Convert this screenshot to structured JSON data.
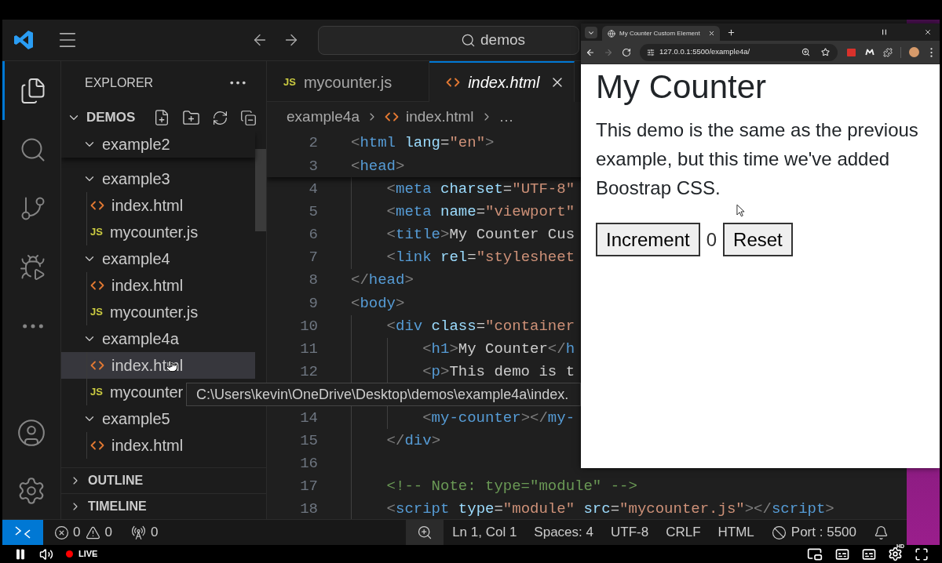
{
  "title_bar": {
    "command_center": {
      "label": "demos"
    }
  },
  "activity_bar": {
    "items": [
      {
        "kind": "explorer",
        "selected": true
      },
      {
        "kind": "search",
        "selected": false
      },
      {
        "kind": "source_control",
        "selected": false
      },
      {
        "kind": "run_debug",
        "selected": false
      },
      {
        "kind": "more",
        "selected": false
      }
    ],
    "bottom": [
      {
        "kind": "account"
      },
      {
        "kind": "settings"
      }
    ]
  },
  "sidebar": {
    "title": "EXPLORER",
    "root": {
      "name": "DEMOS",
      "expanded": true
    },
    "tree": [
      {
        "kind": "folder",
        "name": "example2",
        "expanded": true
      },
      {
        "kind": "folder",
        "name": "example3",
        "expanded": true,
        "children": [
          {
            "kind": "html",
            "name": "index.html",
            "selected": false
          },
          {
            "kind": "js",
            "icon_label": "JS",
            "name": "mycounter.js",
            "selected": false
          }
        ]
      },
      {
        "kind": "folder",
        "name": "example4",
        "expanded": true,
        "children": [
          {
            "kind": "html",
            "name": "index.html",
            "selected": false
          },
          {
            "kind": "js",
            "icon_label": "JS",
            "name": "mycounter.js",
            "selected": false
          }
        ]
      },
      {
        "kind": "folder",
        "name": "example4a",
        "expanded": true,
        "children": [
          {
            "kind": "html",
            "name": "index.html",
            "selected": true
          },
          {
            "kind": "js",
            "icon_label": "JS",
            "name": "mycounter",
            "selected": false
          }
        ]
      },
      {
        "kind": "folder",
        "name": "example5",
        "expanded": true,
        "children": [
          {
            "kind": "html",
            "name": "index.html",
            "selected": false
          }
        ]
      }
    ],
    "sections": [
      {
        "name": "OUTLINE",
        "expanded": false
      },
      {
        "name": "TIMELINE",
        "expanded": false
      }
    ]
  },
  "tooltip": {
    "text": "C:\\Users\\kevin\\OneDrive\\Desktop\\demos\\example4a\\index."
  },
  "editor": {
    "tabs": [
      {
        "kind": "js",
        "icon_label": "JS",
        "label": "mycounter.js",
        "selected": false,
        "preview": false
      },
      {
        "kind": "html",
        "label": "index.html",
        "selected": true,
        "preview": true
      }
    ],
    "breadcrumbs": [
      {
        "kind": "folder",
        "label": "example4a"
      },
      {
        "kind": "html",
        "label": "index.html"
      },
      {
        "kind": "more",
        "label": "…"
      }
    ],
    "lines": [
      {
        "number": "2",
        "tokens": [
          {
            "kind": "punct",
            "text": "<"
          },
          {
            "kind": "tag",
            "text": "html"
          },
          {
            "kind": "attr",
            "text": " lang"
          },
          {
            "kind": "text",
            "text": "="
          },
          {
            "kind": "string",
            "text": "\"en\""
          },
          {
            "kind": "punct",
            "text": ">"
          }
        ]
      },
      {
        "number": "3",
        "tokens": [
          {
            "kind": "punct",
            "text": "<"
          },
          {
            "kind": "tag",
            "text": "head"
          },
          {
            "kind": "punct",
            "text": ">"
          }
        ],
        "children": [
          {
            "number": "4",
            "tokens": [
              {
                "kind": "punct",
                "text": "<"
              },
              {
                "kind": "tag",
                "text": "meta"
              },
              {
                "kind": "attr",
                "text": " charset"
              },
              {
                "kind": "text",
                "text": "="
              },
              {
                "kind": "string",
                "text": "\"UTF-8\""
              }
            ]
          },
          {
            "number": "5",
            "tokens": [
              {
                "kind": "punct",
                "text": "<"
              },
              {
                "kind": "tag",
                "text": "meta"
              },
              {
                "kind": "attr",
                "text": " name"
              },
              {
                "kind": "text",
                "text": "="
              },
              {
                "kind": "string",
                "text": "\"viewport\""
              }
            ]
          },
          {
            "number": "6",
            "tokens": [
              {
                "kind": "punct",
                "text": "<"
              },
              {
                "kind": "tag",
                "text": "title"
              },
              {
                "kind": "punct",
                "text": ">"
              },
              {
                "kind": "text",
                "text": "My Counter Cus"
              }
            ]
          },
          {
            "number": "7",
            "tokens": [
              {
                "kind": "punct",
                "text": "<"
              },
              {
                "kind": "tag",
                "text": "link"
              },
              {
                "kind": "attr",
                "text": " rel"
              },
              {
                "kind": "text",
                "text": "="
              },
              {
                "kind": "string",
                "text": "\"stylesheet"
              }
            ]
          }
        ]
      },
      {
        "number": "8",
        "tokens": [
          {
            "kind": "punct",
            "text": "</"
          },
          {
            "kind": "tag",
            "text": "head"
          },
          {
            "kind": "punct",
            "text": ">"
          }
        ]
      },
      {
        "number": "9",
        "tokens": [
          {
            "kind": "punct",
            "text": "<"
          },
          {
            "kind": "tag",
            "text": "body"
          },
          {
            "kind": "punct",
            "text": ">"
          }
        ],
        "children": [
          {
            "number": "10",
            "tokens": [
              {
                "kind": "punct",
                "text": "<"
              },
              {
                "kind": "tag",
                "text": "div"
              },
              {
                "kind": "attr",
                "text": " class"
              },
              {
                "kind": "text",
                "text": "="
              },
              {
                "kind": "string",
                "text": "\"container"
              }
            ],
            "children": [
              {
                "number": "11",
                "tokens": [
                  {
                    "kind": "punct",
                    "text": "<"
                  },
                  {
                    "kind": "tag",
                    "text": "h1"
                  },
                  {
                    "kind": "punct",
                    "text": ">"
                  },
                  {
                    "kind": "text",
                    "text": "My Counter"
                  },
                  {
                    "kind": "punct",
                    "text": "</"
                  },
                  {
                    "kind": "tag",
                    "text": "h"
                  }
                ]
              },
              {
                "number": "12",
                "tokens": [
                  {
                    "kind": "punct",
                    "text": "<"
                  },
                  {
                    "kind": "tag",
                    "text": "p"
                  },
                  {
                    "kind": "punct",
                    "text": ">"
                  },
                  {
                    "kind": "text",
                    "text": "This demo is t"
                  }
                ]
              },
              {
                "number": "14",
                "tokens": [
                  {
                    "kind": "punct",
                    "text": "<"
                  },
                  {
                    "kind": "tag",
                    "text": "my-counter"
                  },
                  {
                    "kind": "punct",
                    "text": "></"
                  },
                  {
                    "kind": "tag",
                    "text": "my-"
                  }
                ]
              }
            ]
          },
          {
            "number": "15",
            "tokens": [
              {
                "kind": "punct",
                "text": "</"
              },
              {
                "kind": "tag",
                "text": "div"
              },
              {
                "kind": "punct",
                "text": ">"
              }
            ]
          },
          {
            "number": "16"
          },
          {
            "number": "17",
            "tokens": [
              {
                "kind": "comment",
                "text": "<!-- Note: type=\"module\" -->"
              }
            ]
          },
          {
            "number": "18",
            "tokens": [
              {
                "kind": "punct",
                "text": "<"
              },
              {
                "kind": "tag",
                "text": "script"
              },
              {
                "kind": "attr",
                "text": " type"
              },
              {
                "kind": "text",
                "text": "="
              },
              {
                "kind": "string",
                "text": "\"module\""
              },
              {
                "kind": "attr",
                "text": " src"
              },
              {
                "kind": "text",
                "text": "="
              },
              {
                "kind": "string",
                "text": "\"mycounter.js\""
              },
              {
                "kind": "punct",
                "text": "></"
              },
              {
                "kind": "tag",
                "text": "script"
              },
              {
                "kind": "punct",
                "text": ">"
              }
            ]
          }
        ]
      }
    ]
  },
  "status_bar": {
    "left": [
      {
        "kind": "remote"
      },
      {
        "kind": "errors",
        "text": "0"
      },
      {
        "kind": "warnings",
        "text": "0"
      },
      {
        "kind": "ports",
        "text": "0"
      }
    ],
    "right": [
      {
        "kind": "zoom"
      },
      {
        "kind": "text",
        "text": "Ln 1, Col 1"
      },
      {
        "kind": "text",
        "text": "Spaces: 4"
      },
      {
        "kind": "text",
        "text": "UTF-8"
      },
      {
        "kind": "text",
        "text": "CRLF"
      },
      {
        "kind": "text",
        "text": "HTML"
      },
      {
        "kind": "port",
        "text": "Port : 5500"
      },
      {
        "kind": "bell"
      }
    ]
  },
  "browser": {
    "tab": {
      "title": "My Counter Custom Element"
    },
    "nav": [
      {
        "kind": "back",
        "disabled": false
      },
      {
        "kind": "forward",
        "disabled": true
      },
      {
        "kind": "reload",
        "disabled": false
      }
    ],
    "address": "127.0.0.1:5500/example4a/",
    "page": {
      "heading": "My Counter",
      "paragraph": "This demo is the same as the previous example, but this time we've added Boostrap CSS.",
      "controls": [
        {
          "kind": "button",
          "label": "Increment"
        },
        {
          "kind": "value",
          "text": "0"
        },
        {
          "kind": "button",
          "label": "Reset"
        }
      ]
    }
  },
  "player": {
    "live_label": "LIVE",
    "quality_badge": "HD"
  }
}
